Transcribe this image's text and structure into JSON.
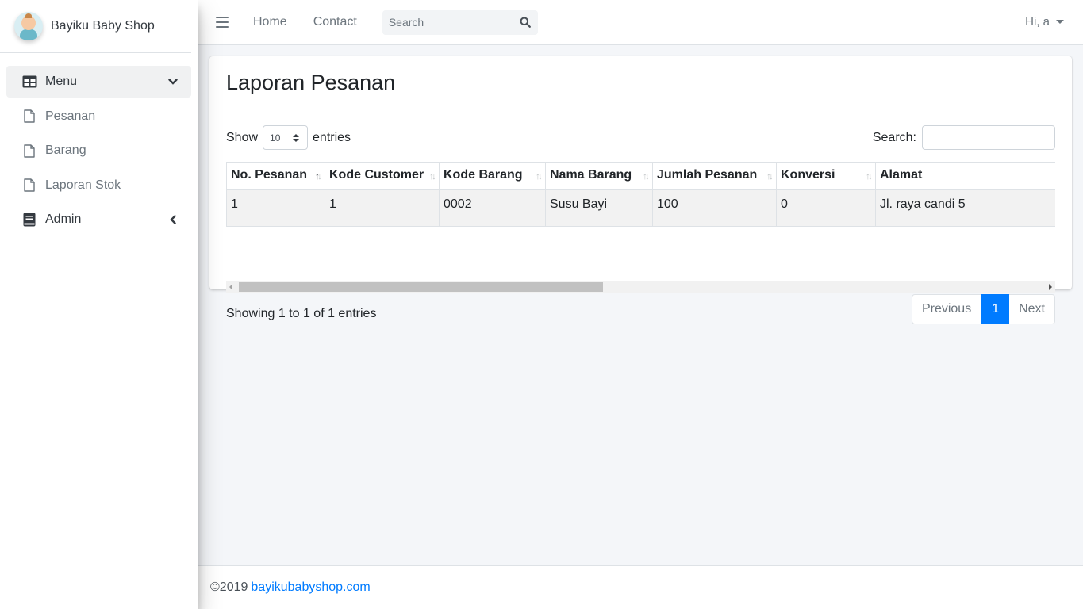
{
  "brand": {
    "name": "Bayiku Baby Shop"
  },
  "sidebar": {
    "items": [
      {
        "label": "Menu",
        "icon": "table-icon",
        "caret": "chevron-down-icon"
      },
      {
        "label": "Pesanan",
        "icon": "file-icon"
      },
      {
        "label": "Barang",
        "icon": "file-icon"
      },
      {
        "label": "Laporan Stok",
        "icon": "file-icon"
      },
      {
        "label": "Admin",
        "icon": "book-icon",
        "caret": "chevron-left-icon"
      }
    ]
  },
  "topbar": {
    "links": [
      "Home",
      "Contact"
    ],
    "search_placeholder": "Search",
    "user_label": "Hi, a"
  },
  "card": {
    "title": "Laporan Pesanan",
    "show_label": "Show",
    "entries_value": "10",
    "entries_label": "entries",
    "search_label": "Search:",
    "columns": [
      "No. Pesanan",
      "Kode Customer",
      "Kode Barang",
      "Nama Barang",
      "Jumlah Pesanan",
      "Konversi",
      "Alamat"
    ],
    "rows": [
      [
        "1",
        "1",
        "0002",
        "Susu Bayi",
        "100",
        "0",
        "Jl. raya candi 5"
      ]
    ],
    "info": "Showing 1 to 1 of 1 entries",
    "pagination": {
      "previous": "Previous",
      "current": "1",
      "next": "Next"
    }
  },
  "footer": {
    "copyright": "©2019",
    "link": "bayikubabyshop.com"
  },
  "colors": {
    "accent": "#007bff",
    "sidebar_active": "#f0f1f2",
    "background": "#f4f6f9"
  }
}
